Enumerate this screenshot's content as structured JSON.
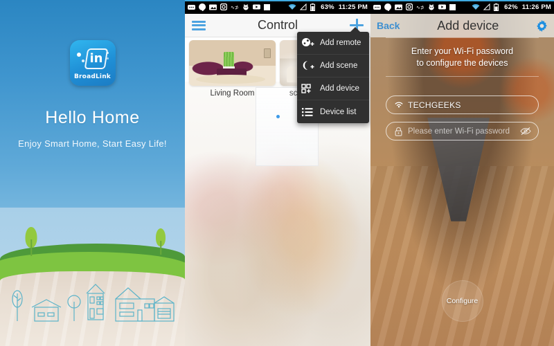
{
  "panel1": {
    "name": "splash-screen",
    "logo": {
      "brand": "BroadLink",
      "mark": "in"
    },
    "title": "Hello Home",
    "subtitle": "Enjoy Smart Home, Start Easy Life!",
    "colors": {
      "sky_top": "#2b86c2",
      "sky_bottom": "#b6d8ec",
      "grass": "#7ec441",
      "grass_dark": "#4e9a3a",
      "ground": "#e9dfd4",
      "outline": "#5bb3c9"
    }
  },
  "panel2": {
    "name": "control-screen",
    "statusbar": {
      "icons": [
        "messages-icon",
        "hangouts-icon",
        "screenshot-icon",
        "instagram-icon",
        "wd-icon",
        "app-icon",
        "youtube-icon",
        "unknown-square-icon"
      ],
      "wifi": "wifi-icon",
      "signal": "signal-icon",
      "battery": "battery-icon",
      "battery_pct": "63%",
      "clock": "11:25 PM"
    },
    "appbar": {
      "menu_icon": "hamburger-icon",
      "title": "Control",
      "add_icon": "plus-icon"
    },
    "cards": [
      {
        "label": "Living Room",
        "image": "living-room-thumbnail"
      },
      {
        "label": "scene of getting up",
        "image": "scene-thumbnail"
      }
    ],
    "page_indicator": {
      "count": 1,
      "active": 0
    },
    "popup_menu": [
      {
        "label": "Add remote",
        "icon": "remote-add-icon"
      },
      {
        "label": "Add scene",
        "icon": "moon-add-icon"
      },
      {
        "label": "Add device",
        "icon": "grid-add-icon"
      },
      {
        "label": "Device list",
        "icon": "list-icon"
      }
    ]
  },
  "panel3": {
    "name": "add-device-screen",
    "statusbar": {
      "battery_pct": "62%",
      "clock": "11:26 PM"
    },
    "appbar": {
      "back_label": "Back",
      "title": "Add device",
      "settings_icon": "gear-icon"
    },
    "instructions_line1": "Enter your Wi-Fi password",
    "instructions_line2": "to configure the devices",
    "ssid_field": {
      "icon": "wifi-icon",
      "value": "TECHGEEKS"
    },
    "password_field": {
      "icon": "lock-icon",
      "placeholder": "Please enter Wi-Fi password",
      "toggle_icon": "eye-off-icon",
      "value": ""
    },
    "configure_button": "Configure",
    "colors": {
      "accent": "#3d8fd0",
      "background": "#b98d5e"
    }
  }
}
